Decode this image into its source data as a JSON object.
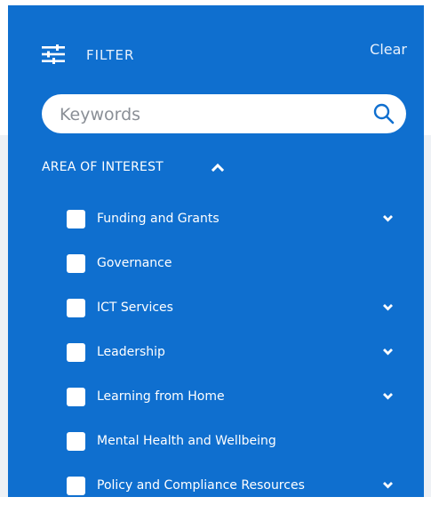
{
  "filter": {
    "icon": "filter-sliders-icon",
    "label": "FILTER",
    "clear_label": "Clear"
  },
  "search": {
    "placeholder": "Keywords",
    "value": "",
    "icon": "search-icon"
  },
  "area_of_interest": {
    "title": "AREA OF INTEREST",
    "expanded": true,
    "items": [
      {
        "label": "Funding and Grants",
        "checked": false,
        "has_children": true
      },
      {
        "label": "Governance",
        "checked": false,
        "has_children": false
      },
      {
        "label": "ICT Services",
        "checked": false,
        "has_children": true
      },
      {
        "label": "Leadership",
        "checked": false,
        "has_children": true
      },
      {
        "label": "Learning from Home",
        "checked": false,
        "has_children": true
      },
      {
        "label": "Mental Health and Wellbeing",
        "checked": false,
        "has_children": false
      },
      {
        "label": "Policy and Compliance Resources",
        "checked": false,
        "has_children": true
      }
    ]
  },
  "colors": {
    "panel": "#0f6fcf",
    "text": "#ffffff",
    "search_icon": "#0f6fcf"
  }
}
